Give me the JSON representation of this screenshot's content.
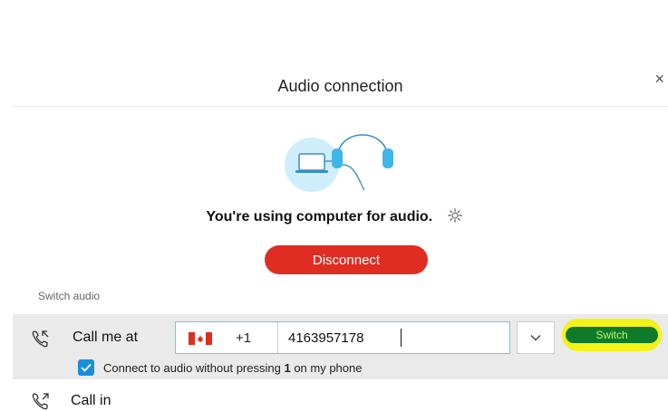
{
  "dialog": {
    "title": "Audio connection",
    "close_glyph": "×"
  },
  "illustration": {
    "icon": "laptop-headphones-icon"
  },
  "status": {
    "text": "You're using computer for audio.",
    "settings_icon": "gear-icon"
  },
  "disconnect": {
    "label": "Disconnect",
    "color": "#e02d23"
  },
  "switch_audio": {
    "section_label": "Switch audio",
    "call_me": {
      "label": "Call me at",
      "icon": "phone-callback-icon",
      "country_flag": "canada-flag-icon",
      "country_code": "+1",
      "phone_number": "4163957178",
      "switch_label": "Switch",
      "highlight_color": "#f3f219",
      "switch_color": "#0f7a2a",
      "checkbox": {
        "checked": true,
        "label_prefix": "Connect to audio without pressing ",
        "label_bold": "1",
        "label_suffix": " on my phone"
      }
    },
    "call_in": {
      "label": "Call in",
      "icon": "phone-outgoing-icon"
    }
  }
}
